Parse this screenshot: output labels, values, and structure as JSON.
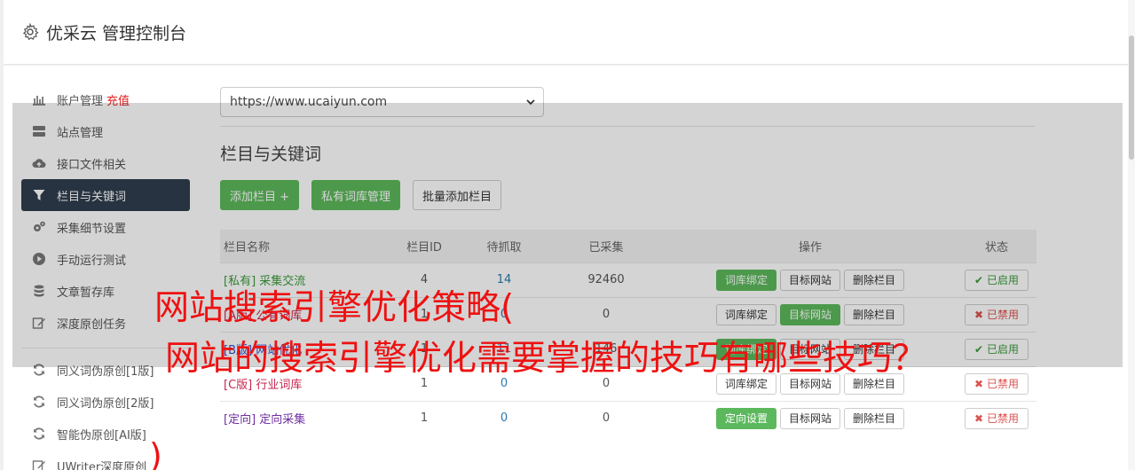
{
  "app": {
    "title": "优采云 管理控制台"
  },
  "sidebar": {
    "items": [
      {
        "label": "账户管理",
        "extra": "充值",
        "icon": "bar-chart-icon"
      },
      {
        "label": "站点管理",
        "icon": "server-icon"
      },
      {
        "label": "接口文件相关",
        "icon": "cloud-upload-icon"
      },
      {
        "label": "栏目与关键词",
        "icon": "filter-icon",
        "active": true
      },
      {
        "label": "采集细节设置",
        "icon": "cogs-icon"
      },
      {
        "label": "手动运行测试",
        "icon": "play-circle-icon"
      },
      {
        "label": "文章暂存库",
        "icon": "database-icon"
      },
      {
        "label": "深度原创任务",
        "icon": "edit-icon"
      },
      {
        "label": "同义词伪原创[1版]",
        "icon": "refresh-icon"
      },
      {
        "label": "同义词伪原创[2版]",
        "icon": "refresh-icon"
      },
      {
        "label": "智能伪原创[AI版]",
        "icon": "refresh-icon"
      },
      {
        "label": "UWriter深度原创",
        "icon": "edit-icon"
      }
    ]
  },
  "site_select": {
    "value": "https://www.ucaiyun.com"
  },
  "section": {
    "title": "栏目与关键词"
  },
  "toolbar": {
    "add_label": "添加栏目 +",
    "private_label": "私有词库管理",
    "batch_label": "批量添加栏目"
  },
  "table": {
    "headers": [
      "栏目名称",
      "栏目ID",
      "待抓取",
      "已采集",
      "操作",
      "状态"
    ],
    "rows": [
      {
        "tag": "[私有]",
        "name": "采集交流",
        "id": "4",
        "pending": "14",
        "collected": "92460",
        "op1": "词库绑定",
        "op2": "目标网站",
        "op3": "删除栏目",
        "status": "已启用"
      },
      {
        "tag": "[A版]",
        "name": "公有词库",
        "id": "1",
        "pending": "0",
        "collected": "0",
        "op1": "词库绑定",
        "op2": "目标网站",
        "op3": "删除栏目",
        "status": "已禁用"
      },
      {
        "tag": "[B版]",
        "name": "网站优化",
        "id": "1",
        "pending": "11",
        "collected": "146",
        "op1": "词库绑定",
        "op2": "目标网站",
        "op3": "删除栏目",
        "status": "已启用"
      },
      {
        "tag": "[C版]",
        "name": "行业词库",
        "id": "1",
        "pending": "0",
        "collected": "0",
        "op1": "词库绑定",
        "op2": "目标网站",
        "op3": "删除栏目",
        "status": "已禁用"
      },
      {
        "tag": "[定向]",
        "name": "定向采集",
        "id": "1",
        "pending": "0",
        "collected": "0",
        "op1": "定向设置",
        "op2": "目标网站",
        "op3": "删除栏目",
        "status": "已禁用"
      }
    ]
  },
  "watermark": {
    "line1": "网站搜索引擎优化策略(",
    "line2": "网站的搜索引擎优化需要掌握的技巧有哪些技巧？",
    "paren": ")"
  },
  "colors": {
    "active_nav": "#2f3e4e",
    "green": "#5cb85c",
    "watermark": "#ee1111"
  }
}
